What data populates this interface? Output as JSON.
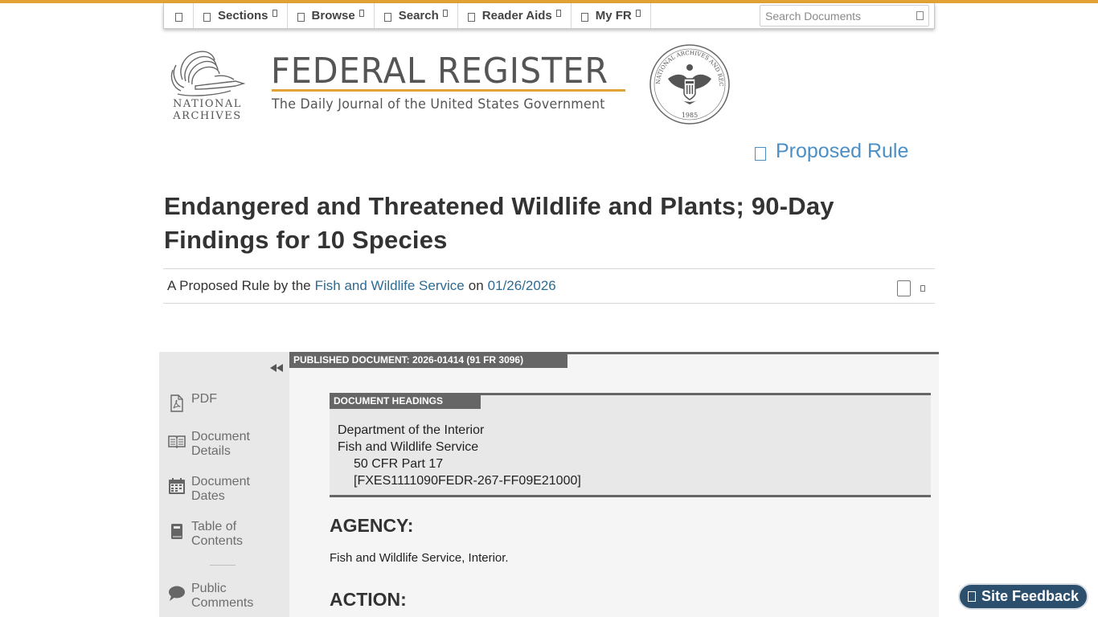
{
  "nav": {
    "items": [
      {
        "label": "Sections"
      },
      {
        "label": "Browse"
      },
      {
        "label": "Search"
      },
      {
        "label": "Reader Aids"
      },
      {
        "label": "My FR"
      }
    ],
    "search_placeholder": "Search Documents"
  },
  "header": {
    "logo_line1": "NATIONAL",
    "logo_line2": "ARCHIVES",
    "title": "FEDERAL REGISTER",
    "subtitle": "The Daily Journal of the United States Government",
    "seal_text": "NATIONAL ARCHIVES AND RECORDS ADMINISTRATION",
    "seal_year": "1985"
  },
  "document": {
    "type_label": "Proposed Rule",
    "title": "Endangered and Threatened Wildlife and Plants; 90-Day Findings for 10 Species",
    "byline_prefix": "A Proposed Rule by the",
    "agency_link": "Fish and Wildlife Service",
    "byline_on": "on",
    "date_link": "01/26/2026"
  },
  "sidebar": {
    "items": [
      {
        "label": "PDF",
        "icon": "pdf-icon"
      },
      {
        "label": "Document Details",
        "icon": "book-icon"
      },
      {
        "label": "Document Dates",
        "icon": "calendar-icon"
      },
      {
        "label": "Table of Contents",
        "icon": "toc-icon"
      },
      {
        "label": "Public Comments",
        "icon": "comment-icon"
      }
    ]
  },
  "content": {
    "published_tab": "PUBLISHED DOCUMENT: 2026-01414 (91 FR 3096)",
    "headings_tab": "DOCUMENT HEADINGS",
    "headings": [
      "Department of the Interior",
      "Fish and Wildlife Service",
      "50 CFR Part 17",
      "[FXES1111090FEDR-267-FF09E21000]"
    ],
    "agency_heading": "AGENCY:",
    "agency_text": "Fish and Wildlife Service, Interior.",
    "action_heading": "ACTION:"
  },
  "feedback": {
    "label": "Site Feedback"
  },
  "colors": {
    "accent": "#e2a235",
    "link": "#2e6b93",
    "type_label": "#4b8fc5",
    "feedback_bg": "#2d4f6e"
  }
}
